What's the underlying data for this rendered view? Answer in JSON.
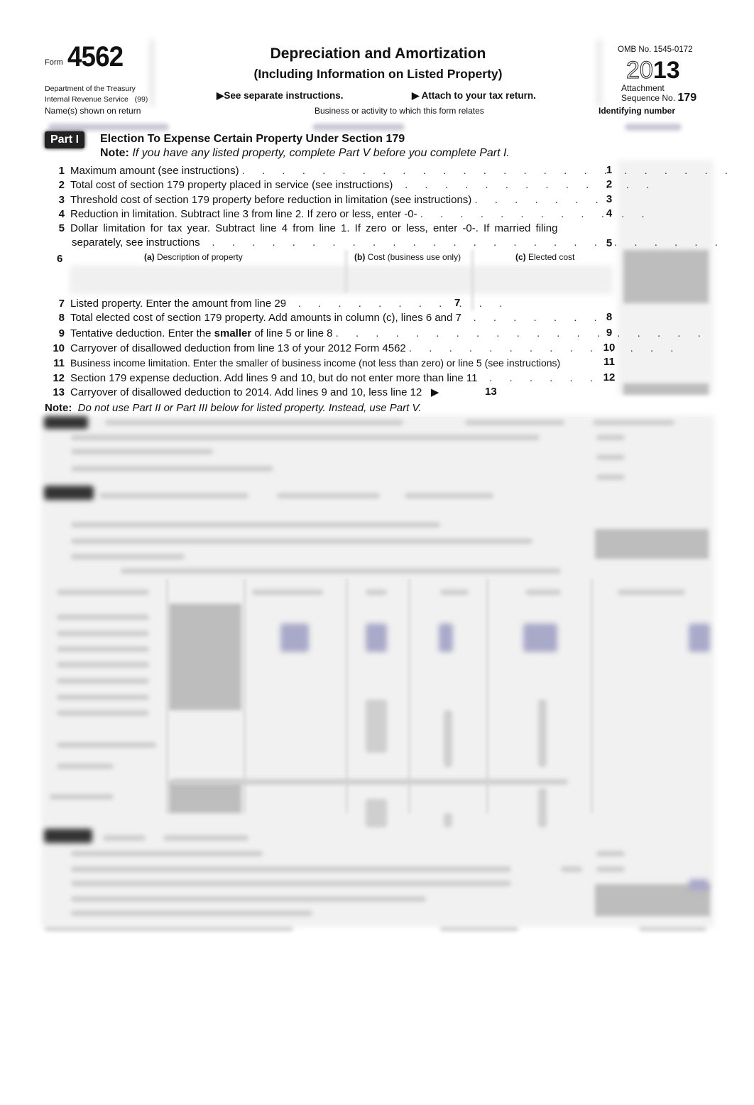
{
  "header": {
    "form_word": "Form",
    "form_number": "4562",
    "department": "Department of the Treasury",
    "irs": "Internal Revenue Service",
    "irs_code": "(99)",
    "title": "Depreciation and Amortization",
    "subtitle": "(Including Information on Listed Property)",
    "see_instructions": "See separate instructions.",
    "attach": "Attach to your tax return.",
    "omb": "OMB No. 1545-0172",
    "year_outline": "20",
    "year_bold": "13",
    "attachment": "Attachment",
    "sequence_label": "Sequence No.",
    "sequence_no": "179",
    "names_label": "Name(s) shown on return",
    "business_label": "Business or activity to which this form relates",
    "id_label": "Identifying number"
  },
  "part1": {
    "badge": "Part I",
    "title": "Election To Expense Certain Property Under Section 179",
    "note_label": "Note:",
    "note_text": "If you have any listed property, complete Part V before you complete Part I.",
    "lines": [
      {
        "num": "1",
        "text": "Maximum amount (see instructions)",
        "dots": ". . . . . . . . . . . . . . . . . . . . . . . . .",
        "box": "1"
      },
      {
        "num": "2",
        "text": "Total cost of section 179 property placed in service (see instructions)",
        "dots": ". . . . . . . . . . . . .",
        "box": "2"
      },
      {
        "num": "3",
        "text": "Threshold cost of section 179 property before reduction in limitation (see instructions)",
        "dots": ". . . . . . .",
        "box": "3"
      },
      {
        "num": "4",
        "text": "Reduction in limitation. Subtract line 3 from line 2. If zero or less, enter -0-",
        "dots": ". . . . . . . . . . . .",
        "box": "4"
      },
      {
        "num": "5",
        "text": "Dollar limitation for tax year. Subtract line 4 from line 1. If zero or less, enter -0-. If married filing",
        "text2": "separately, see instructions",
        "dots": ". . . . . . . . . . . . . . . . . . . . . . . . . .",
        "box": "5"
      }
    ],
    "line6": {
      "num": "6",
      "col_a_letter": "(a)",
      "col_a": "Description of property",
      "col_b_letter": "(b)",
      "col_b": "Cost (business use only)",
      "col_c_letter": "(c)",
      "col_c": "Elected cost"
    },
    "line7": {
      "num": "7",
      "text": "Listed property. Enter the amount from line 29",
      "dots": ". . . . . . . . . . .",
      "box": "7"
    },
    "lines_b": [
      {
        "num": "8",
        "text": "Total elected cost of section 179 property. Add amounts in column (c), lines 6 and 7",
        "dots": ". . . . . . .",
        "box": "8"
      },
      {
        "num": "9",
        "text_pre": "Tentative deduction. Enter the ",
        "text_bold": "smaller",
        "text_post": " of line 5 or line 8",
        "dots": ". . . . . . . . . . . . . . . . . . .",
        "box": "9"
      },
      {
        "num": "10",
        "text": "Carryover of disallowed deduction from line 13 of your 2012 Form 4562",
        "dots": ". . . . . . . . . . . . . .",
        "box": "10"
      },
      {
        "num": "11",
        "text": "Business income limitation. Enter the smaller of business income (not less than zero) or line 5 (see instructions)",
        "dots": "",
        "box": "11"
      },
      {
        "num": "12",
        "text": "Section 179 expense deduction. Add lines 9 and 10, but do not enter more than line 11",
        "dots": ". . . . . .",
        "box": "12"
      }
    ],
    "line13": {
      "num": "13",
      "text": "Carryover of disallowed deduction to 2014. Add lines 9 and 10, less line 12",
      "arrow": "▶",
      "box": "13"
    },
    "note2_label": "Note:",
    "note2_text": "Do not use Part II or Part III below for listed property. Instead, use Part V."
  }
}
